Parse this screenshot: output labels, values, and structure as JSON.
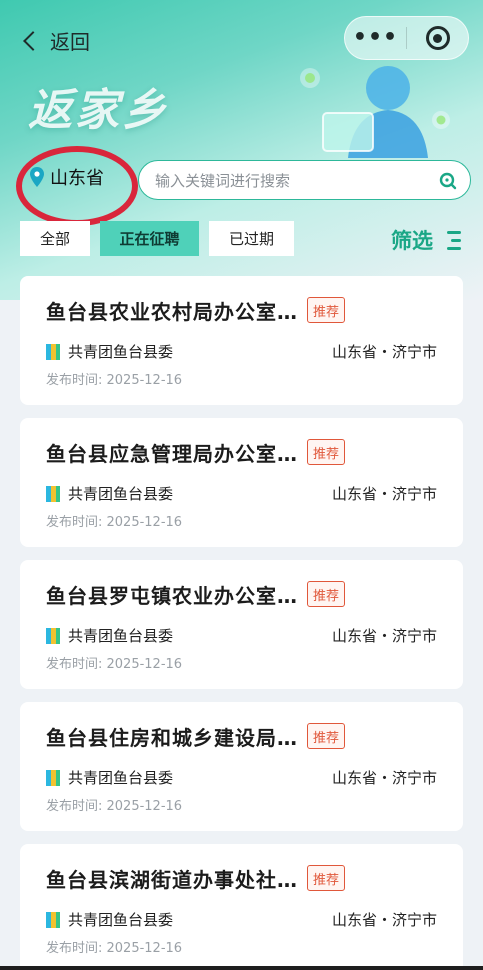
{
  "nav": {
    "back_label": "返回",
    "menu_dots": "•••"
  },
  "brand": {
    "title": "返家乡"
  },
  "location": {
    "province": "山东省"
  },
  "search": {
    "placeholder": "输入关键词进行搜索"
  },
  "tabs": [
    {
      "label": "全部",
      "active": false
    },
    {
      "label": "正在征聘",
      "active": true
    },
    {
      "label": "已过期",
      "active": false
    }
  ],
  "filter": {
    "label": "筛选"
  },
  "jobs": [
    {
      "title": "鱼台县农业农村局办公室…",
      "badge": "推荐",
      "org": "共青团鱼台县委",
      "region": "山东省・济宁市",
      "date": "发布时间: 2025-12-16"
    },
    {
      "title": "鱼台县应急管理局办公室…",
      "badge": "推荐",
      "org": "共青团鱼台县委",
      "region": "山东省・济宁市",
      "date": "发布时间: 2025-12-16"
    },
    {
      "title": "鱼台县罗屯镇农业办公室…",
      "badge": "推荐",
      "org": "共青团鱼台县委",
      "region": "山东省・济宁市",
      "date": "发布时间: 2025-12-16"
    },
    {
      "title": "鱼台县住房和城乡建设局…",
      "badge": "推荐",
      "org": "共青团鱼台县委",
      "region": "山东省・济宁市",
      "date": "发布时间: 2025-12-16"
    },
    {
      "title": "鱼台县滨湖街道办事处社…",
      "badge": "推荐",
      "org": "共青团鱼台县委",
      "region": "山东省・济宁市",
      "date": "发布时间: 2025-12-16"
    }
  ],
  "colors": {
    "accent": "#1aa786",
    "active_tab": "#4fd1b9",
    "badge": "#e0573a",
    "annotation": "#d9263b"
  }
}
